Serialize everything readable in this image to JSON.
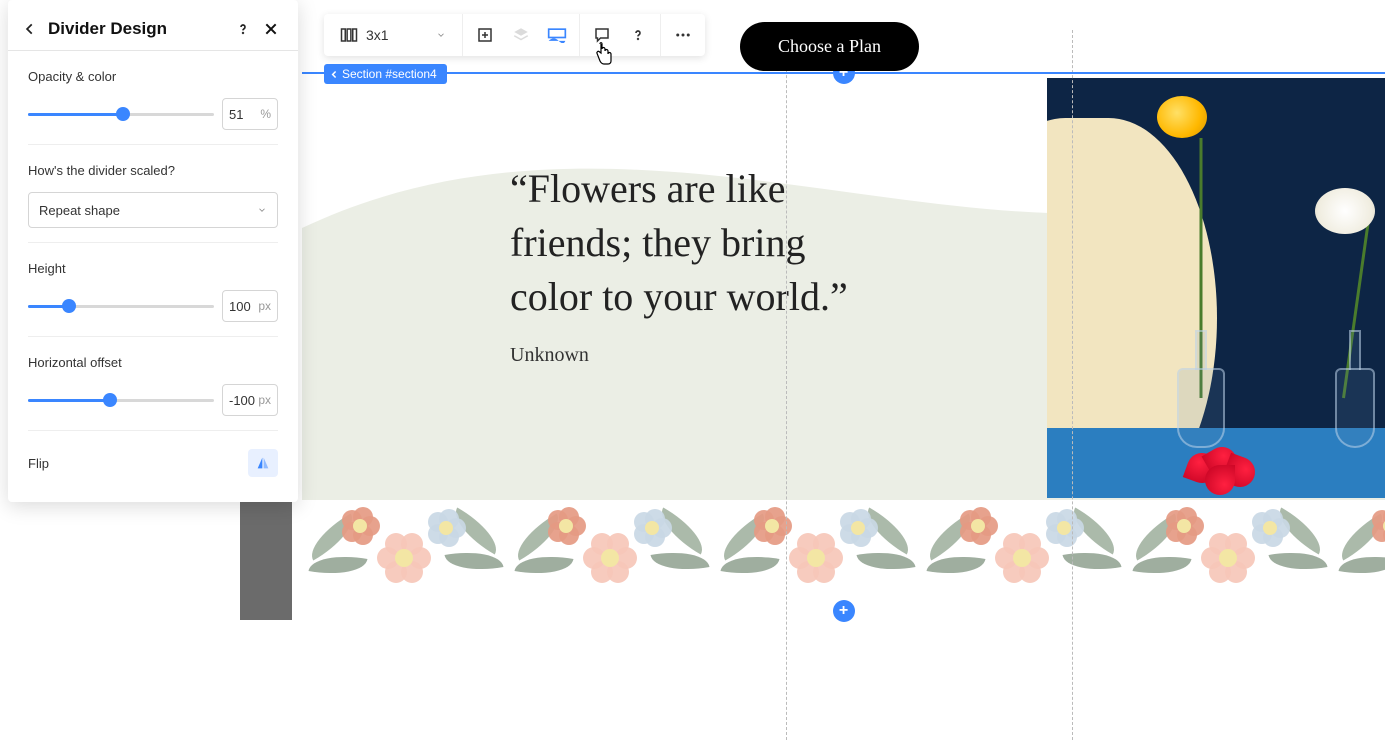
{
  "panel": {
    "title": "Divider Design",
    "opacity_label": "Opacity & color",
    "opacity_value": "51",
    "opacity_unit": "%",
    "scale_label": "How's the divider scaled?",
    "scale_value": "Repeat shape",
    "height_label": "Height",
    "height_value": "100",
    "height_unit": "px",
    "offset_label": "Horizontal offset",
    "offset_value": "-100",
    "offset_unit": "px",
    "flip_label": "Flip"
  },
  "toolbar": {
    "layout_label": "3x1"
  },
  "cta": {
    "label": "Choose a Plan"
  },
  "section_tag": "Section #section4",
  "content": {
    "quote": "“Flowers are like friends; they bring color to your world.”",
    "author": "Unknown"
  }
}
